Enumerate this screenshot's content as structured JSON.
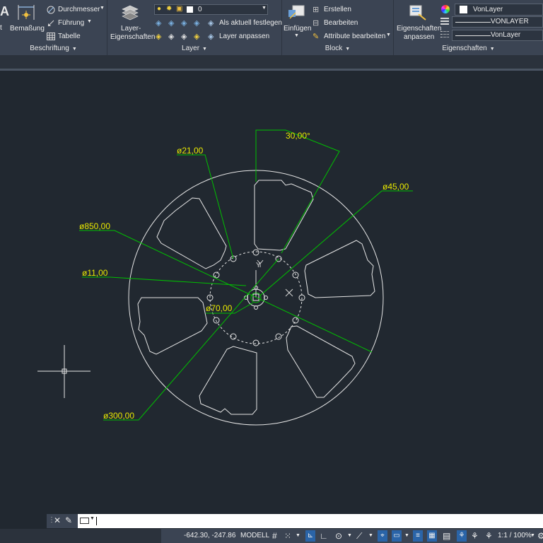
{
  "ribbon": {
    "annotation": {
      "partial_label": "t",
      "dimension_label": "Bemaßung",
      "diameter_label": "Durchmesser",
      "leader_label": "Führung",
      "table_label": "Tabelle",
      "panel_title": "Beschriftung"
    },
    "layer": {
      "properties_label_1": "Layer-",
      "properties_label_2": "Eigenschaften",
      "current_layer": "0",
      "set_current_label": "Als aktuell festlegen",
      "match_label": "Layer anpassen",
      "panel_title": "Layer"
    },
    "block": {
      "insert_label": "Einfügen",
      "create_label": "Erstellen",
      "edit_label": "Bearbeiten",
      "edit_attributes_label": "Attribute bearbeiten",
      "panel_title": "Block"
    },
    "properties": {
      "match_label_1": "Eigenschaften",
      "match_label_2": "anpassen",
      "color_value": "VonLayer",
      "linetype_value": "VONLAYER",
      "lineweight_value": "VonLayer",
      "panel_title": "Eigenschaften"
    }
  },
  "drawing": {
    "dim_angle": "30,00°",
    "dim_d21": "ø21,00",
    "dim_d45": "ø45,00",
    "dim_d850": "ø850,00",
    "dim_d11": "ø11,00",
    "dim_d70": "ø70,00",
    "dim_d300": "ø300,00",
    "ucs_y": "Y",
    "colors": {
      "geometry": "#e6e6e6",
      "dimension_text": "#e8e800",
      "dimension_line": "#00c000",
      "background": "#212830"
    }
  },
  "statusbar": {
    "coordinates": "-642.30, -247.86",
    "model_label": "MODELL",
    "scale_label": "1:1 / 100%"
  }
}
